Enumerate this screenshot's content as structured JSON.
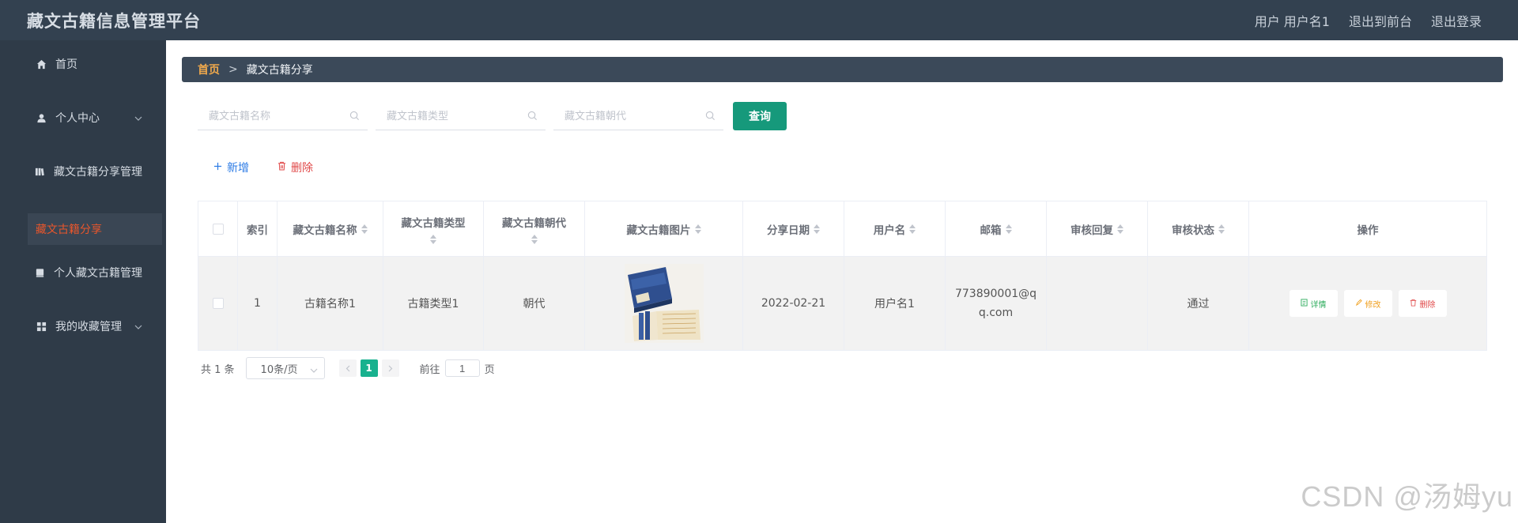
{
  "header": {
    "title": "藏文古籍信息管理平台",
    "user_label": "用户 用户名1",
    "to_front_label": "退出到前台",
    "logout_label": "退出登录"
  },
  "sidebar": {
    "items": [
      {
        "label": "首页",
        "icon": "home-icon"
      },
      {
        "label": "个人中心",
        "icon": "user-icon"
      },
      {
        "label": "藏文古籍分享管理",
        "icon": "book-icon"
      },
      {
        "label": "藏文古籍分享",
        "icon": ""
      },
      {
        "label": "个人藏文古籍管理",
        "icon": "book-icon"
      },
      {
        "label": "我的收藏管理",
        "icon": "grid-icon"
      }
    ]
  },
  "breadcrumb": {
    "home": "首页",
    "separator": ">",
    "current": "藏文古籍分享"
  },
  "search": {
    "name_placeholder": "藏文古籍名称",
    "type_placeholder": "藏文古籍类型",
    "dynasty_placeholder": "藏文古籍朝代",
    "query_label": "查询"
  },
  "actions": {
    "add_label": "新增",
    "delete_label": "删除"
  },
  "table": {
    "headers": {
      "index": "索引",
      "name": "藏文古籍名称",
      "type": "藏文古籍类型",
      "dynasty": "藏文古籍朝代",
      "image": "藏文古籍图片",
      "date": "分享日期",
      "username": "用户名",
      "email": "邮箱",
      "reply": "审核回复",
      "status": "审核状态",
      "ops": "操作"
    },
    "rows": [
      {
        "index": "1",
        "name": "古籍名称1",
        "type": "古籍类型1",
        "dynasty": "朝代",
        "date": "2022-02-21",
        "username": "用户名1",
        "email_line1": "773890001@q",
        "email_line2": "q.com",
        "reply": "",
        "status": "通过",
        "detail_label": "详情",
        "edit_label": "修改",
        "delete_label": "删除"
      }
    ]
  },
  "pagination": {
    "total": "共 1 条",
    "page_size": "10条/页",
    "current_page": "1",
    "goto_prefix": "前往",
    "goto_value": "1",
    "goto_suffix": "页"
  },
  "watermark": "CSDN @汤姆yu",
  "colors": {
    "header_bg": "#334150",
    "sidebar_bg": "#2f3b48",
    "active_text": "#e8562c",
    "primary": "#16997b",
    "page_active": "#18b18e"
  }
}
